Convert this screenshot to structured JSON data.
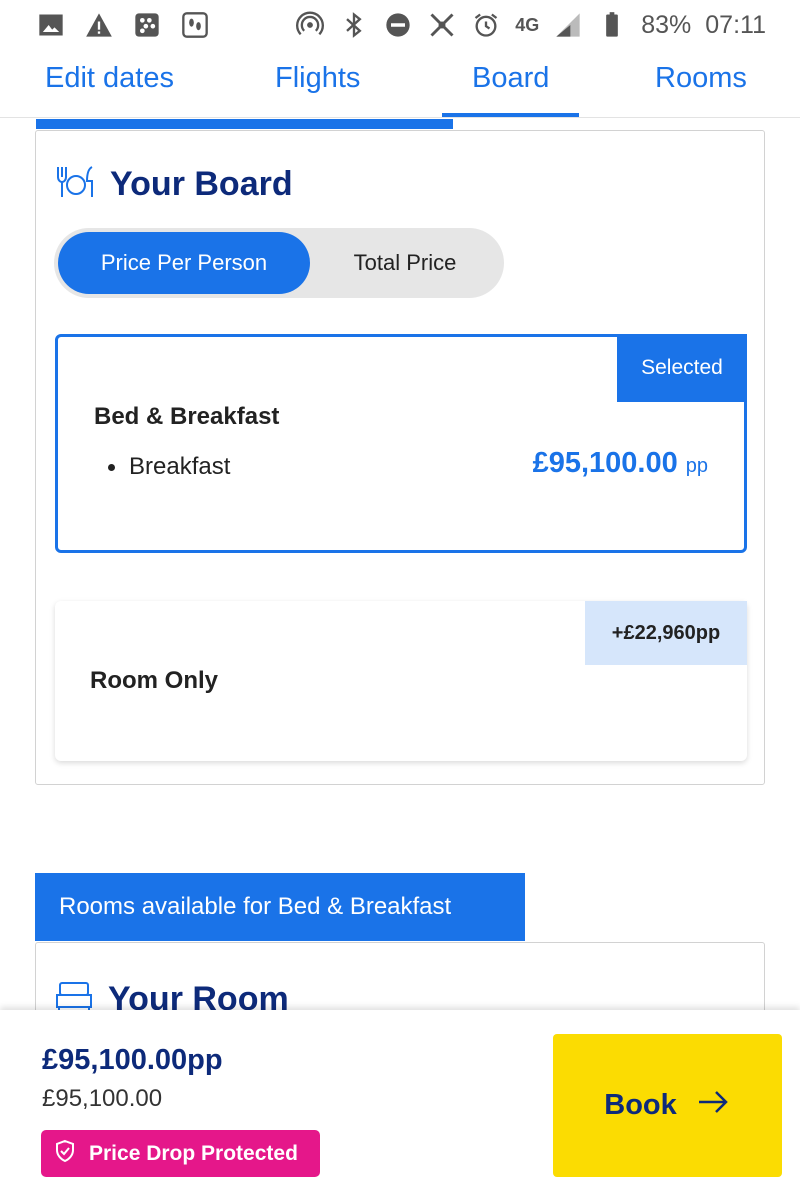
{
  "status_bar": {
    "battery": "83%",
    "time": "07:11",
    "network": "4G",
    "left_icons": [
      "image-icon",
      "warning-icon",
      "bbm-icon",
      "steps-icon"
    ],
    "right_icons": [
      "hotspot-icon",
      "bluetooth-icon",
      "dnd-icon",
      "no-signal-icon",
      "alarm-icon",
      "signal-icon",
      "battery-icon"
    ]
  },
  "tabs": [
    {
      "label": "Edit dates",
      "active": false
    },
    {
      "label": "Flights",
      "active": false
    },
    {
      "label": "Board",
      "active": true
    },
    {
      "label": "Rooms",
      "active": false
    }
  ],
  "board": {
    "title": "Your Board",
    "icon": "cutlery-icon",
    "toggle": {
      "per_person": "Price Per Person",
      "total": "Total Price",
      "selected": "per_person"
    },
    "options": [
      {
        "name": "Bed & Breakfast",
        "badge": "Selected",
        "items": [
          "Breakfast"
        ],
        "price": "£95,100.00",
        "price_unit": "pp"
      },
      {
        "name": "Room Only",
        "badge": "+£22,960pp"
      }
    ]
  },
  "rooms": {
    "banner": "Rooms available for Bed & Breakfast",
    "title": "Your Room",
    "icon": "bed-icon"
  },
  "footer": {
    "price_pp": "£95,100.00pp",
    "price_total": "£95,100.00",
    "badge": "Price Drop Protected",
    "book_label": "Book"
  },
  "colors": {
    "accent": "#1a73e8",
    "navy": "#0d2a7a",
    "book_yellow": "#fbdc02",
    "badge_pink": "#e5178a",
    "light_blue": "#d6e6fb"
  }
}
